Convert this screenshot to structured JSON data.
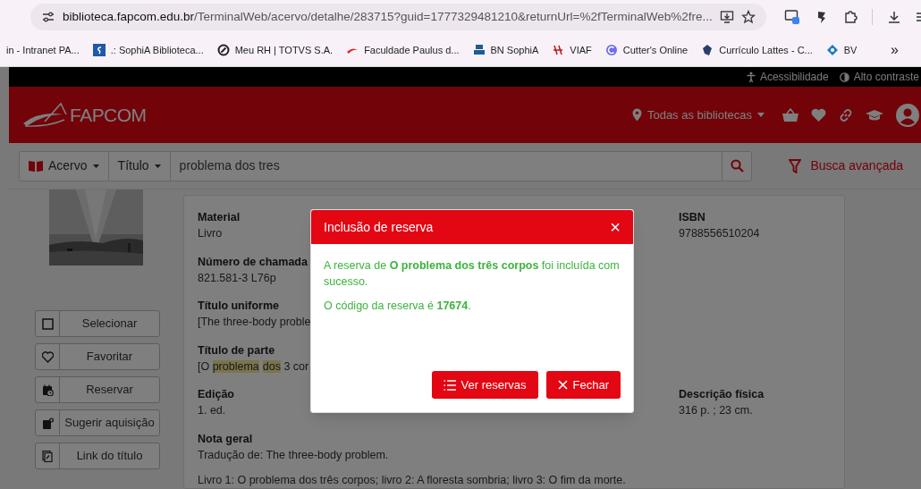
{
  "browser": {
    "url": "biblioteca.fapcom.edu.br/TerminalWeb/acervo/detalhe/283715?guid=1777329481210&returnUrl=%2fTerminalWeb%2fre...",
    "bookmarks": [
      {
        "label": "in - Intranet PA..."
      },
      {
        "label": ".: SophiA Biblioteca..."
      },
      {
        "label": "Meu RH | TOTVS S.A."
      },
      {
        "label": "Faculdade Paulus d..."
      },
      {
        "label": "BN SophiA"
      },
      {
        "label": "VIAF"
      },
      {
        "label": "Cutter's Online"
      },
      {
        "label": "Currículo Lattes - C..."
      },
      {
        "label": "BV"
      }
    ],
    "overflow": "»"
  },
  "top_strip": {
    "links": [
      "Acessibilidade",
      "Alto contraste"
    ]
  },
  "header": {
    "logo": "FAPCOM",
    "library_select": "Todas as bibliotecas"
  },
  "search": {
    "scope": "Acervo",
    "field": "Título",
    "query": "problema dos tres",
    "advanced": "Busca avançada"
  },
  "actions": [
    {
      "label": "Selecionar"
    },
    {
      "label": "Favoritar"
    },
    {
      "label": "Reservar"
    },
    {
      "label": "Sugerir aquisição"
    },
    {
      "label": "Link do título"
    }
  ],
  "details": [
    {
      "label": "Material",
      "value": [
        {
          "text": "Livro",
          "highlight": false
        }
      ],
      "right_label": "ISBN",
      "right_value": "9788556510204"
    },
    {
      "label": "Número de chamada",
      "value": [
        {
          "text": "821.581-3 L76p",
          "highlight": false
        }
      ]
    },
    {
      "label": "Título uniforme",
      "value": [
        {
          "text": "[The three-body proble",
          "highlight": false
        }
      ]
    },
    {
      "label": "Título de parte",
      "value": [
        {
          "text": "[O ",
          "highlight": false
        },
        {
          "text": "problema",
          "highlight": true
        },
        {
          "text": "dos",
          "highlight": true
        },
        {
          "text": " 3 cor",
          "highlight": false
        }
      ]
    },
    {
      "label": "Edição",
      "value": [
        {
          "text": "1. ed.",
          "highlight": false
        }
      ],
      "right_label": "Descrição física",
      "right_value": "316 p. ; 23 cm."
    },
    {
      "label": "Nota geral",
      "value": [
        {
          "text": "Tradução de: The three-body problem.",
          "highlight": false
        }
      ]
    }
  ],
  "note": "Livro 1: O problema dos três corpos; livro 2: A floresta sombria; livro 3: O fim da morte.",
  "modal": {
    "title": "Inclusão de reserva",
    "close": "×",
    "messages": [
      "A reserva de **O problema dos três corpos** foi incluída com sucesso.",
      "O código da reserva é **17674**."
    ],
    "buttons": [
      {
        "label": "Ver reservas"
      },
      {
        "label": "Fechar"
      }
    ]
  }
}
